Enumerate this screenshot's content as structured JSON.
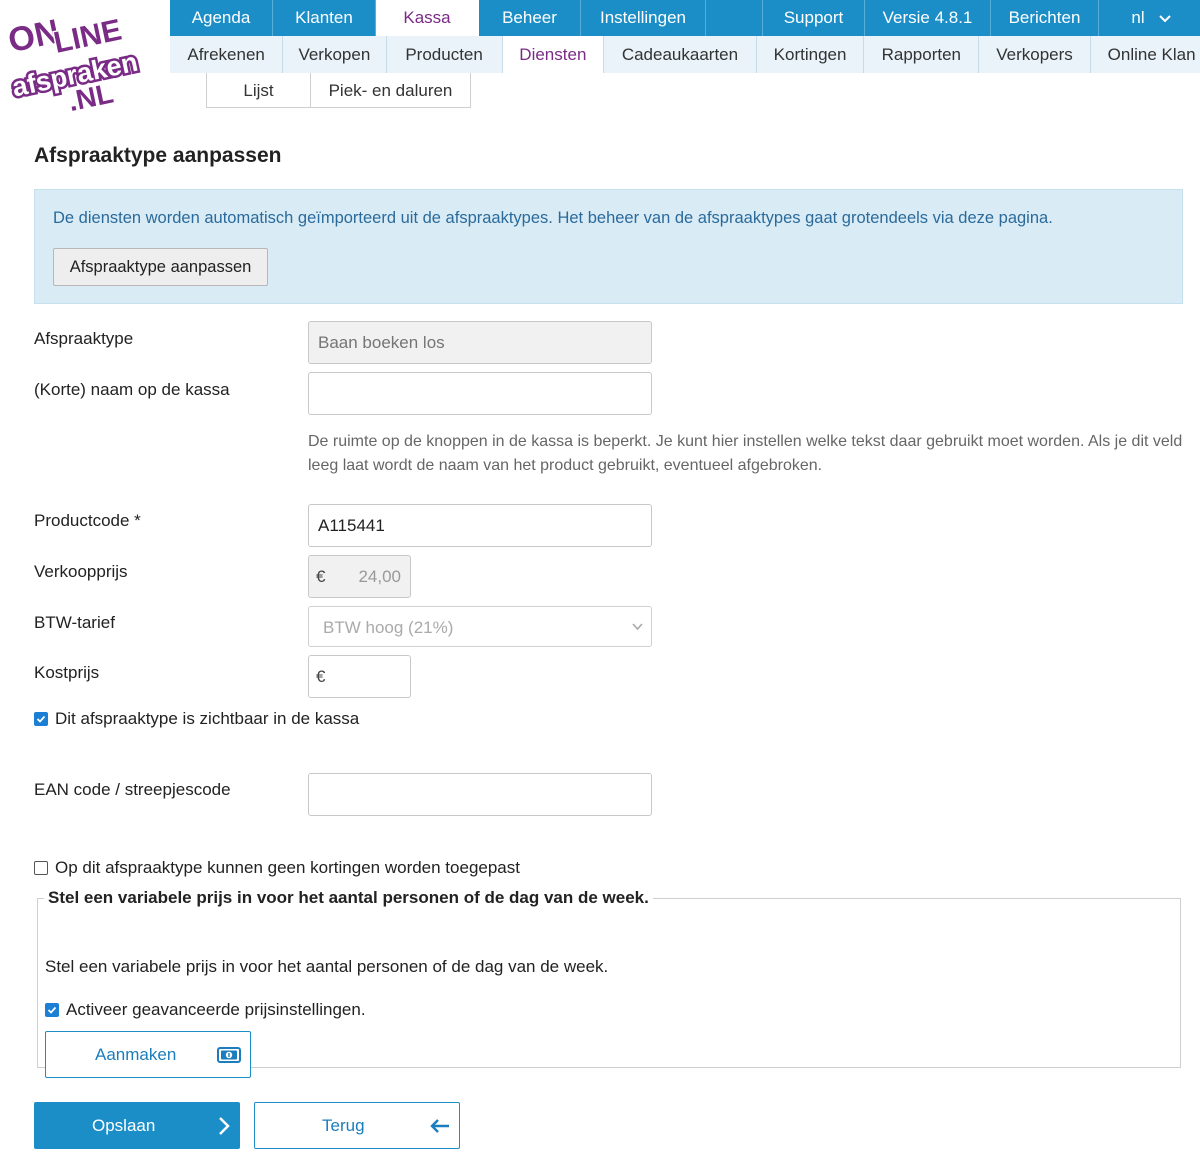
{
  "logo": {
    "line1": "ON",
    "line2": "LINE",
    "line3": "afspraken",
    "line4": ".NL"
  },
  "topnav": [
    {
      "label": "Agenda",
      "active": false
    },
    {
      "label": "Klanten",
      "active": false
    },
    {
      "label": "Kassa",
      "active": true
    },
    {
      "label": "Beheer",
      "active": false
    },
    {
      "label": "Instellingen",
      "active": false
    },
    {
      "label": "Support",
      "active": false
    },
    {
      "label": "Versie 4.8.1",
      "active": false
    },
    {
      "label": "Berichten",
      "active": false
    }
  ],
  "language": "nl",
  "subnav": [
    {
      "label": "Afrekenen"
    },
    {
      "label": "Verkopen"
    },
    {
      "label": "Producten"
    },
    {
      "label": "Diensten",
      "active": true
    },
    {
      "label": "Cadeaukaarten"
    },
    {
      "label": "Kortingen"
    },
    {
      "label": "Rapporten"
    },
    {
      "label": "Verkopers"
    },
    {
      "label": "Online Klan"
    }
  ],
  "subsubnav": [
    {
      "label": "Lijst"
    },
    {
      "label": "Piek- en daluren"
    }
  ],
  "page_title": "Afspraaktype aanpassen",
  "info": {
    "message": "De diensten worden automatisch geïmporteerd uit de afspraaktypes. Het beheer van de afspraaktypes gaat grotendeels via deze pagina.",
    "button": "Afspraaktype aanpassen"
  },
  "form": {
    "afspraaktype": {
      "label": "Afspraaktype",
      "placeholder": "Baan boeken los"
    },
    "korte_naam": {
      "label": "(Korte) naam op de kassa",
      "value": "",
      "help": "De ruimte op de knoppen in de kassa is beperkt. Je kunt hier instellen welke tekst daar gebruikt moet worden. Als je dit veld leeg laat wordt de naam van het product gebruikt, eventueel afgebroken."
    },
    "productcode": {
      "label": "Productcode *",
      "value": "A115441"
    },
    "verkoopprijs": {
      "label": "Verkoopprijs",
      "currency": "€",
      "value": "24,00"
    },
    "btw": {
      "label": "BTW-tarief",
      "value": "BTW hoog (21%)"
    },
    "kostprijs": {
      "label": "Kostprijs",
      "currency": "€",
      "value": ""
    },
    "zichtbaar": {
      "label": "Dit afspraaktype is zichtbaar in de kassa",
      "checked": true
    },
    "ean": {
      "label": "EAN code / streepjescode",
      "value": ""
    },
    "geen_kortingen": {
      "label": "Op dit afspraaktype kunnen geen kortingen worden toegepast",
      "checked": false
    }
  },
  "variable_price": {
    "legend": "Stel een variabele prijs in voor het aantal personen of de dag van de week.",
    "text": "Stel een variabele prijs in voor het aantal personen of de dag van de week.",
    "checkbox_label": "Activeer geavanceerde prijsinstellingen.",
    "checked": true,
    "create_button": "Aanmaken"
  },
  "actions": {
    "save": "Opslaan",
    "back": "Terug"
  },
  "colors": {
    "primary": "#1b8ec8",
    "active_text": "#7a2b86",
    "info_bg": "#d9ecf6",
    "logo": "#7a2b86"
  }
}
